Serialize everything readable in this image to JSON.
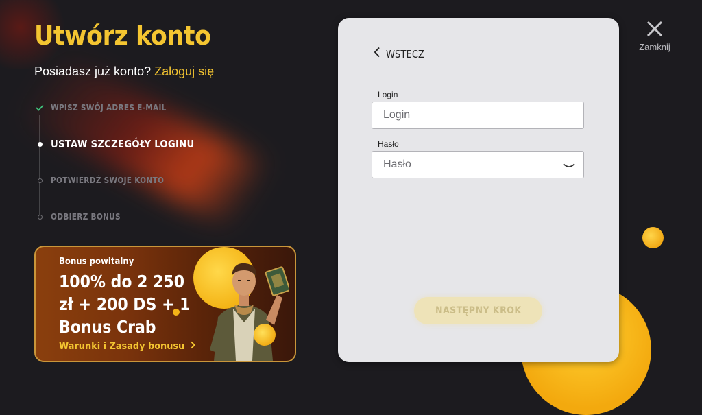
{
  "header": {
    "title": "Utwórz konto",
    "subtitle_prefix": "Posiadasz już konto?",
    "login_link": "Zaloguj się"
  },
  "steps": [
    {
      "label": "WPISZ SWÓJ ADRES E-MAIL",
      "state": "done"
    },
    {
      "label": "USTAW SZCZEGÓŁY LOGINU",
      "state": "active"
    },
    {
      "label": "POTWIERDŹ SWOJE KONTO",
      "state": "pending"
    },
    {
      "label": "ODBIERZ BONUS",
      "state": "pending"
    }
  ],
  "bonus": {
    "label": "Bonus powitalny",
    "main": "100% do 2 250 zł + 200 DS + 1 Bonus Crab",
    "link": "Warunki i Zasady bonusu"
  },
  "form": {
    "back_label": "WSTECZ",
    "login": {
      "label": "Login",
      "placeholder": "Login",
      "value": ""
    },
    "password": {
      "label": "Hasło",
      "placeholder": "Hasło",
      "value": ""
    },
    "next_label": "NASTĘPNY KROK"
  },
  "close": {
    "label": "Zamknij"
  },
  "colors": {
    "accent": "#f4c531",
    "background": "#1c1b1f",
    "card": "#e6e6e9",
    "button_disabled": "#eee3b8"
  },
  "icons": [
    "check-icon",
    "chevron-left-icon",
    "eye-closed-icon",
    "close-icon",
    "chevron-right-icon"
  ]
}
